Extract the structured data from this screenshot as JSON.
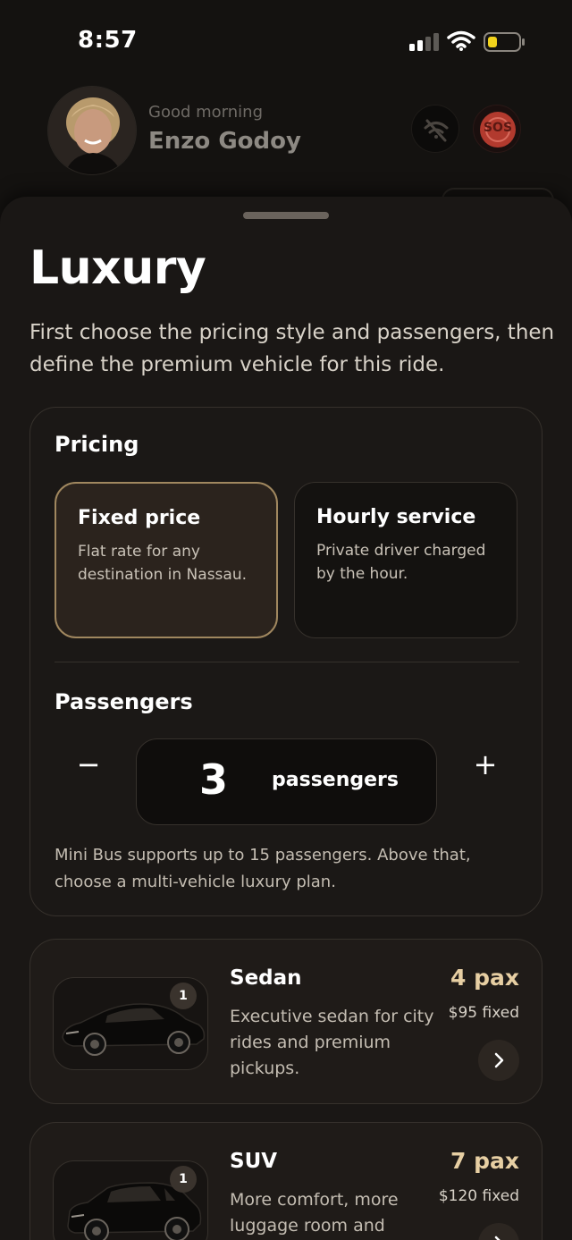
{
  "status": {
    "time": "8:57"
  },
  "header": {
    "greeting": "Good morning",
    "user_name": "Enzo Godoy",
    "sos_label": "SOS"
  },
  "sheet": {
    "title": "Luxury",
    "subtitle": "First choose the pricing style and passengers, then define the premium vehicle for this ride."
  },
  "pricing": {
    "label": "Pricing",
    "options": [
      {
        "title": "Fixed price",
        "desc": "Flat rate for any destination in Nassau.",
        "selected": true
      },
      {
        "title": "Hourly service",
        "desc": "Private driver charged by the hour.",
        "selected": false
      }
    ]
  },
  "passengers": {
    "label": "Passengers",
    "minus": "−",
    "plus": "+",
    "count": "3",
    "unit": "passengers",
    "note": "Mini Bus supports up to 15 passengers. Above that, choose a multi-vehicle luxury plan."
  },
  "vehicles": [
    {
      "name": "Sedan",
      "desc": "Executive sedan for city rides and premium pickups.",
      "pax": "4 pax",
      "price": "$95 fixed",
      "qty": "1",
      "icon": "chevron-right-icon"
    },
    {
      "name": "SUV",
      "desc": "More comfort, more luggage room and",
      "pax": "7 pax",
      "price": "$120 fixed",
      "qty": "1",
      "icon": "chevron-right-icon"
    }
  ],
  "colors": {
    "accent": "#a0875f",
    "pax": "#e7cfa3",
    "background": "#141210",
    "sheet": "#1a1715",
    "sos": "#b23a2e"
  }
}
